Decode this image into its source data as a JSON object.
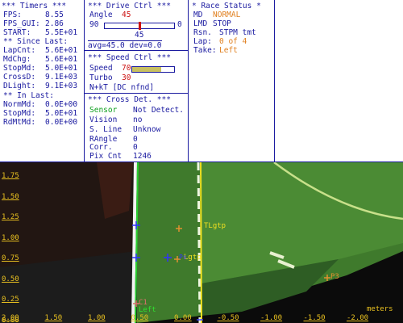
{
  "timers": {
    "header": "*** Timers ***",
    "fps_label": "FPS:",
    "fps_value": "8.55",
    "fps_gui_label": "FPS_GUI:",
    "fps_gui_value": "2.86",
    "start_label": "START:",
    "start_value": "5.5E+01",
    "since_header": "** Since Last:",
    "lapcnt_label": "LapCnt:",
    "lapcnt_value": "5.6E+01",
    "mdchg_label": "MdChg:",
    "mdchg_value": "5.6E+01",
    "stopmd_label": "StopMd:",
    "stopmd_value": "5.0E+01",
    "crossd_label": "CrossD:",
    "crossd_value": "9.1E+03",
    "dlight_label": "DLight:",
    "dlight_value": "9.1E+03",
    "inlast_header": "** In Last:",
    "normmd_label": "NormMd:",
    "normmd_value": "0.0E+00",
    "stopmd2_label": "StopMd:",
    "stopmd2_value": "5.0E+01",
    "rdmtmd_label": "RdMtMd:",
    "rdmtmd_value": "0.0E+00"
  },
  "drive": {
    "header": "***  Drive Ctrl  ***",
    "angle_label": "Angle",
    "angle_value": "45",
    "slider_min": "90",
    "slider_max": "0",
    "slider_level": 0.5,
    "slider_value": "45",
    "stats": "avg=45.0  dev=0.0",
    "speed_header": "***  Speed Ctrl  ***",
    "speed_label": "Speed",
    "speed_value": "70",
    "speed_level": 0.7,
    "turbo_label": "Turbo",
    "turbo_value": "30",
    "nkt": "N+kT [DC nfnd]",
    "cross_header": "*** Cross Det. ***",
    "sensor_label": "Sensor",
    "sensor_value": "Not Detect.",
    "vision_label": "Vision",
    "vision_value": "no",
    "sline_label": "S. Line",
    "sline_value": "Unknow",
    "rangle_label": "RAngle",
    "rangle_value": "0",
    "corr_label": "Corr.",
    "corr_value": "0",
    "pixcnt_label": "Pix Cnt",
    "pixcnt_value": "1246"
  },
  "race": {
    "header": "* Race Status *",
    "md_label": "MD",
    "md_value": "NORMAL",
    "lmd_label": "LMD",
    "lmd_value": "STOP",
    "rsn_label": "Rsn.",
    "rsn_value": "STPM tmt",
    "lap_label": "Lap:",
    "lap_value": "0 of 4",
    "take_label": "Take:",
    "take_value": "Left"
  },
  "view": {
    "y_ticks": [
      "1.75",
      "1.50",
      "1.25",
      "1.00",
      "0.75",
      "0.50",
      "0.25",
      "0.00"
    ],
    "x_ticks": [
      "2.00",
      "1.50",
      "1.00",
      "0.50",
      "0.00",
      "-0.50",
      "-1.00",
      "-1.50",
      "-2.00"
    ],
    "unit": "meters",
    "labels": {
      "tlgtp": "TLgtp",
      "lgtp": "Lgtp",
      "p3": "P3",
      "left": "Left",
      "c1": "C1",
      "ps": "Ps"
    }
  }
}
